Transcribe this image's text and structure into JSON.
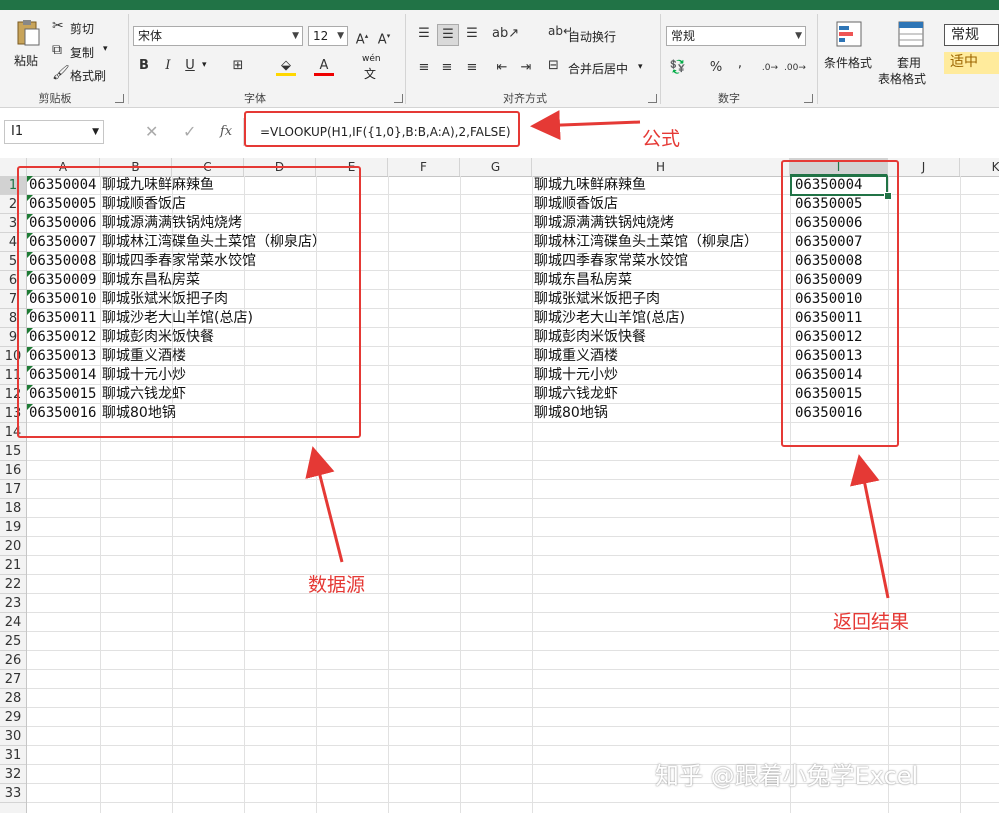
{
  "ribbon": {
    "clipboard": {
      "paste": "粘贴",
      "cut": "剪切",
      "copy": "复制",
      "format_painter": "格式刷",
      "label": "剪贴板"
    },
    "font": {
      "name": "宋体",
      "size": "12",
      "label": "字体",
      "bold": "B",
      "italic": "I",
      "underline": "U",
      "phonetic": "wén"
    },
    "alignment": {
      "wrap": "自动换行",
      "merge": "合并后居中",
      "label": "对齐方式"
    },
    "number": {
      "format": "常规",
      "percent": "%",
      "comma": ",",
      "label": "数字"
    },
    "styles": {
      "conditional": "条件格式",
      "table_line1": "套用",
      "table_line2": "表格格式",
      "normal": "常规",
      "neutral": "适中"
    }
  },
  "formula_bar": {
    "name_box": "I1",
    "fx": "fx",
    "formula": "=VLOOKUP(H1,IF({1,0},B:B,A:A),2,FALSE)"
  },
  "columns": [
    "A",
    "B",
    "C",
    "D",
    "E",
    "F",
    "G",
    "H",
    "I",
    "J",
    "K"
  ],
  "rows": [
    "1",
    "2",
    "3",
    "4",
    "5",
    "6",
    "7",
    "8",
    "9",
    "10",
    "11",
    "12",
    "13",
    "14",
    "15",
    "16",
    "17",
    "18",
    "19",
    "20",
    "21",
    "22",
    "23",
    "24",
    "25",
    "26",
    "27",
    "28",
    "29",
    "30",
    "31",
    "32",
    "33"
  ],
  "data_source": [
    {
      "code": "06350004",
      "name": "聊城九味鲜麻辣鱼"
    },
    {
      "code": "06350005",
      "name": "聊城顺香饭店"
    },
    {
      "code": "06350006",
      "name": "聊城源满满铁锅炖烧烤"
    },
    {
      "code": "06350007",
      "name": "聊城林江湾碟鱼头土菜馆（柳泉店）"
    },
    {
      "code": "06350008",
      "name": "聊城四季春家常菜水饺馆"
    },
    {
      "code": "06350009",
      "name": "聊城东昌私房菜"
    },
    {
      "code": "06350010",
      "name": "聊城张斌米饭把子肉"
    },
    {
      "code": "06350011",
      "name": "聊城沙老大山羊馆(总店)"
    },
    {
      "code": "06350012",
      "name": "聊城彭肉米饭快餐"
    },
    {
      "code": "06350013",
      "name": "聊城重义酒楼"
    },
    {
      "code": "06350014",
      "name": "聊城十元小炒"
    },
    {
      "code": "06350015",
      "name": "聊城六钱龙虾"
    },
    {
      "code": "06350016",
      "name": "聊城80地锅"
    }
  ],
  "lookup_names": [
    "聊城九味鲜麻辣鱼",
    "聊城顺香饭店",
    "聊城源满满铁锅炖烧烤",
    "聊城林江湾碟鱼头土菜馆（柳泉店）",
    "聊城四季春家常菜水饺馆",
    "聊城东昌私房菜",
    "聊城张斌米饭把子肉",
    "聊城沙老大山羊馆(总店)",
    "聊城彭肉米饭快餐",
    "聊城重义酒楼",
    "聊城十元小炒",
    "聊城六钱龙虾",
    "聊城80地锅"
  ],
  "results": [
    "06350004",
    "06350005",
    "06350006",
    "06350007",
    "06350008",
    "06350009",
    "06350010",
    "06350011",
    "06350012",
    "06350013",
    "06350014",
    "06350015",
    "06350016"
  ],
  "annotations": {
    "formula": "公式",
    "data_source": "数据源",
    "result": "返回结果"
  },
  "watermark": "知乎 @跟着小兔学Excel",
  "colors": {
    "annotation_red": "#e53935",
    "excel_green": "#217346"
  }
}
